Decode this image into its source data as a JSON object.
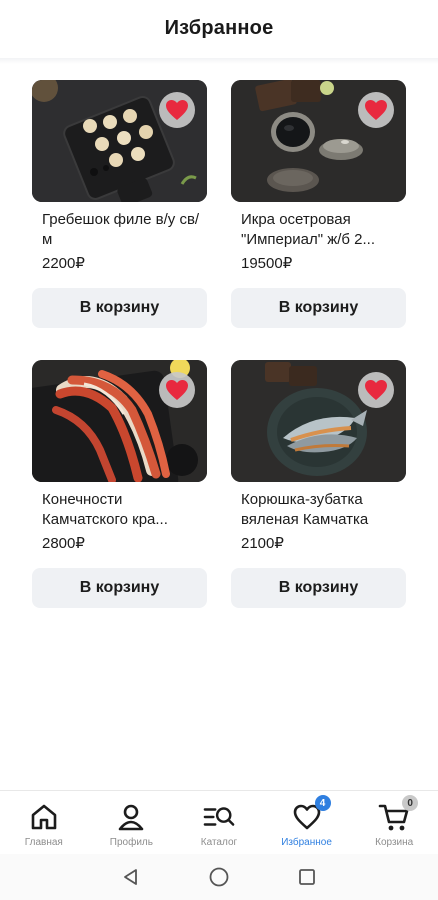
{
  "header": {
    "title": "Избранное"
  },
  "products": [
    {
      "name": "Гребешок филе в/у св/м",
      "price": "2200₽",
      "cart_label": "В корзину"
    },
    {
      "name": "Икра осетровая \"Империал\" ж/б 2...",
      "price": "19500₽",
      "cart_label": "В корзину"
    },
    {
      "name": "Конечности Камчатского кра...",
      "price": "2800₽",
      "cart_label": "В корзину"
    },
    {
      "name": "Корюшка-зубатка вяленая Камчатка",
      "price": "2100₽",
      "cart_label": "В корзину"
    }
  ],
  "tabbar": {
    "items": [
      {
        "label": "Главная",
        "icon": "home-icon"
      },
      {
        "label": "Профиль",
        "icon": "profile-icon"
      },
      {
        "label": "Каталог",
        "icon": "catalog-search-icon"
      },
      {
        "label": "Избранное",
        "icon": "heart-icon",
        "badge": "4",
        "active": true
      },
      {
        "label": "Корзина",
        "icon": "cart-icon",
        "badge": "0"
      }
    ]
  },
  "system_nav": {
    "icons": [
      "back-icon",
      "home-circle-icon",
      "recents-icon"
    ]
  },
  "colors": {
    "accent": "#2f7fe0",
    "favorite": "#e8293f",
    "button_bg": "#eff1f4"
  }
}
